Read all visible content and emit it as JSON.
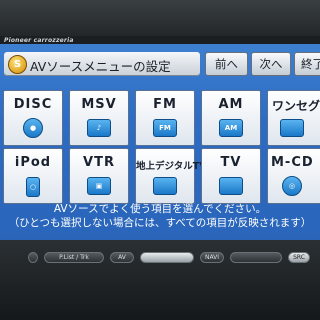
{
  "brand": "Pioneer carrozzeria",
  "header": {
    "badge": "S",
    "title": "AVソースメニューの設定",
    "prev_label": "前へ",
    "next_label": "次へ",
    "end_label": "終了"
  },
  "tiles": [
    {
      "label": "DISC",
      "icon": "disc-icon"
    },
    {
      "label": "MSV",
      "icon": "music-server-icon"
    },
    {
      "label": "FM",
      "icon": "radio-fm-icon",
      "icon_text": "FM"
    },
    {
      "label": "AM",
      "icon": "radio-am-icon",
      "icon_text": "AM"
    },
    {
      "label": "ワンセグ",
      "icon": "tv-icon"
    },
    {
      "label": "iPod",
      "icon": "ipod-icon"
    },
    {
      "label": "VTR",
      "icon": "vtr-icon"
    },
    {
      "label": "地上デジタルTV",
      "icon": "digital-tv-icon"
    },
    {
      "label": "TV",
      "icon": "tv-icon"
    },
    {
      "label": "M-CD",
      "icon": "multi-cd-icon"
    }
  ],
  "message": {
    "line1": "AVソースでよく使う項目を選んでください。",
    "line2": "（ひとつも選択しない場合には、すべての項目が反映されます）"
  },
  "hardware": {
    "btn_list": "P.List / Trk",
    "btn_av": "AV",
    "btn_navi": "NAVI",
    "btn_src": "SRC"
  },
  "colors": {
    "screen": "#2c6cc4",
    "tile": "#ffffff",
    "icon": "#1a78c8",
    "header_button": "#e3e8ed"
  }
}
